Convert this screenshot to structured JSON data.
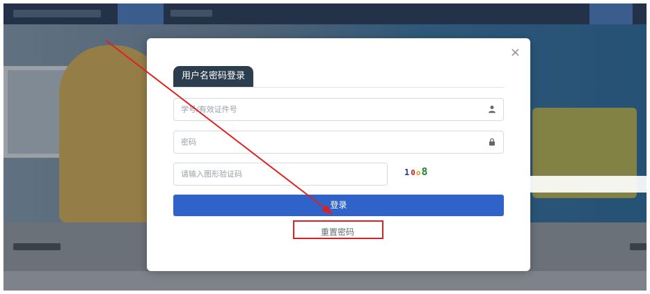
{
  "login_modal": {
    "tab_label": "用户名密码登录",
    "close_icon": "×",
    "username": {
      "placeholder": "学号/有效证件号",
      "value": ""
    },
    "password": {
      "placeholder": "密码",
      "value": ""
    },
    "captcha": {
      "placeholder": "请输入图形验证码",
      "value": "",
      "image_text": [
        "1",
        "0",
        "o",
        "8"
      ]
    },
    "login_button": "登录",
    "reset_link": "重置密码"
  },
  "icons": {
    "user": "user-icon",
    "lock": "lock-icon",
    "close": "close-icon"
  },
  "colors": {
    "primary": "#2f63c9",
    "tab_bg": "#2c3d4d",
    "annotation": "#e02020"
  }
}
